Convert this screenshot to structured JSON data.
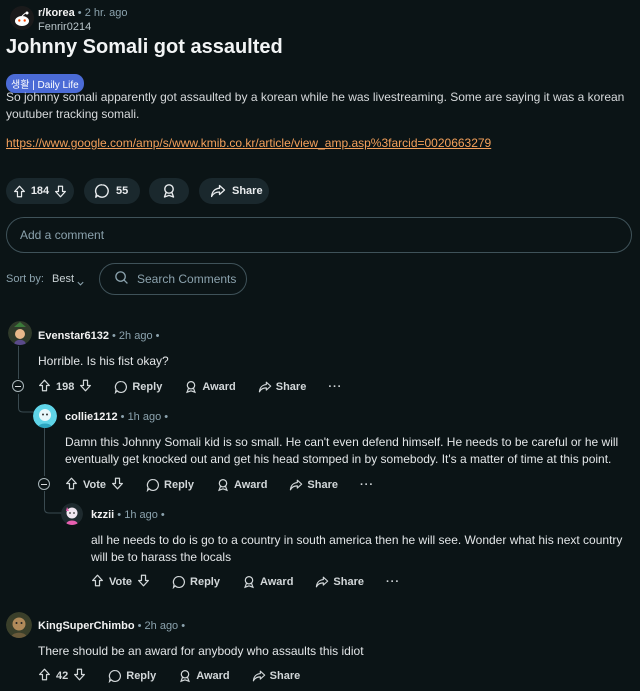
{
  "post": {
    "subreddit": "r/korea",
    "time": "2 hr. ago",
    "author": "Fenrir0214",
    "title": "Johnny Somali got assaulted",
    "flair": "생활 | Daily Life",
    "body": "So johnny somali apparently got assaulted by a korean while he was livestreaming. Some are saying it was a korean youtuber tracking somali.",
    "link": "https://www.google.com/amp/s/www.kmib.co.kr/article/view_amp.asp%3farcid=0020663279",
    "votes": "184",
    "comments": "55",
    "share_label": "Share"
  },
  "composer": {
    "placeholder": "Add a comment"
  },
  "sort": {
    "label": "Sort by:",
    "value": "Best"
  },
  "search": {
    "placeholder": "Search Comments"
  },
  "labels": {
    "reply": "Reply",
    "award": "Award",
    "share": "Share",
    "vote": "Vote",
    "more": "···"
  },
  "comments": [
    {
      "user": "Evenstar6132",
      "time": "• 2h ago •",
      "text": "Horrible. Is his fist okay?",
      "votes": "198"
    },
    {
      "user": "collie1212",
      "time": "• 1h ago •",
      "text": "Damn this Johnny Somali kid is so small. He can't even defend himself. He needs to be careful or he will eventually get knocked out and get his head stomped in by somebody. It's a matter of time at this point.",
      "votes": "Vote"
    },
    {
      "user": "kzzii",
      "time": "• 1h ago •",
      "text": "all he needs to do is go to a country in south america then he will see. Wonder what his next country will be to harass the locals",
      "votes": "Vote"
    },
    {
      "user": "KingSuperChimbo",
      "time": "• 2h ago •",
      "text": "There should be an award for anybody who assaults this idiot",
      "votes": "42"
    }
  ]
}
